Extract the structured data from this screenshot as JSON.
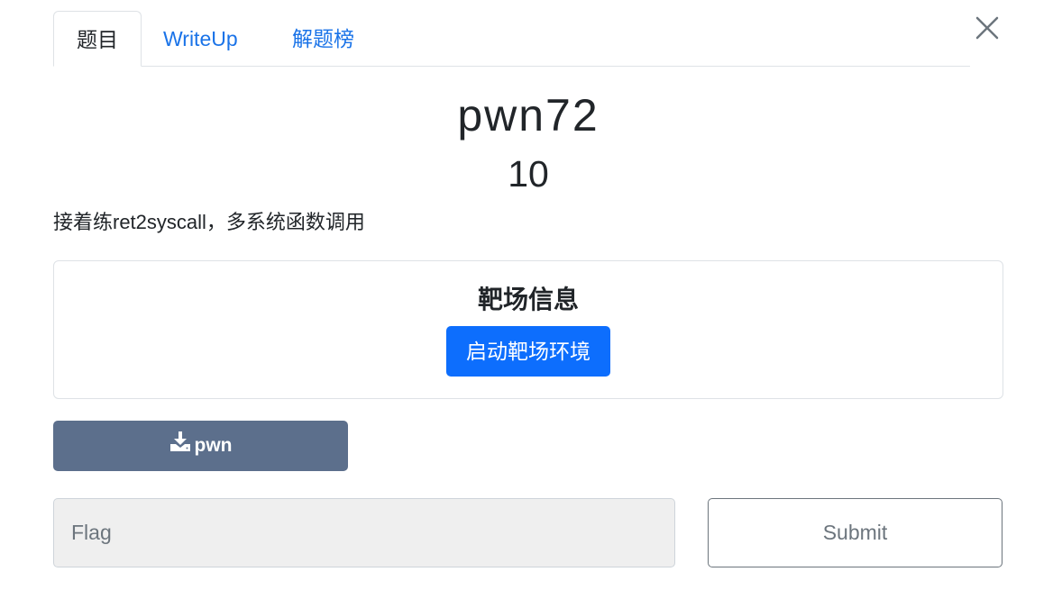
{
  "tabs": [
    {
      "label": "题目",
      "active": true
    },
    {
      "label": "WriteUp",
      "active": false
    },
    {
      "label": "解题榜",
      "active": false
    }
  ],
  "challenge": {
    "name": "pwn72",
    "score": "10",
    "description": "接着练ret2syscall，多系统函数调用"
  },
  "range": {
    "title": "靶场信息",
    "start_label": "启动靶场环境"
  },
  "download": {
    "label": "pwn",
    "icon": "download-icon"
  },
  "flag": {
    "placeholder": "Flag",
    "value": ""
  },
  "submit_label": "Submit",
  "colors": {
    "primary": "#0d6efd",
    "link": "#1a73e8",
    "download_bg": "#5c6f8c",
    "input_bg": "#efefef"
  }
}
